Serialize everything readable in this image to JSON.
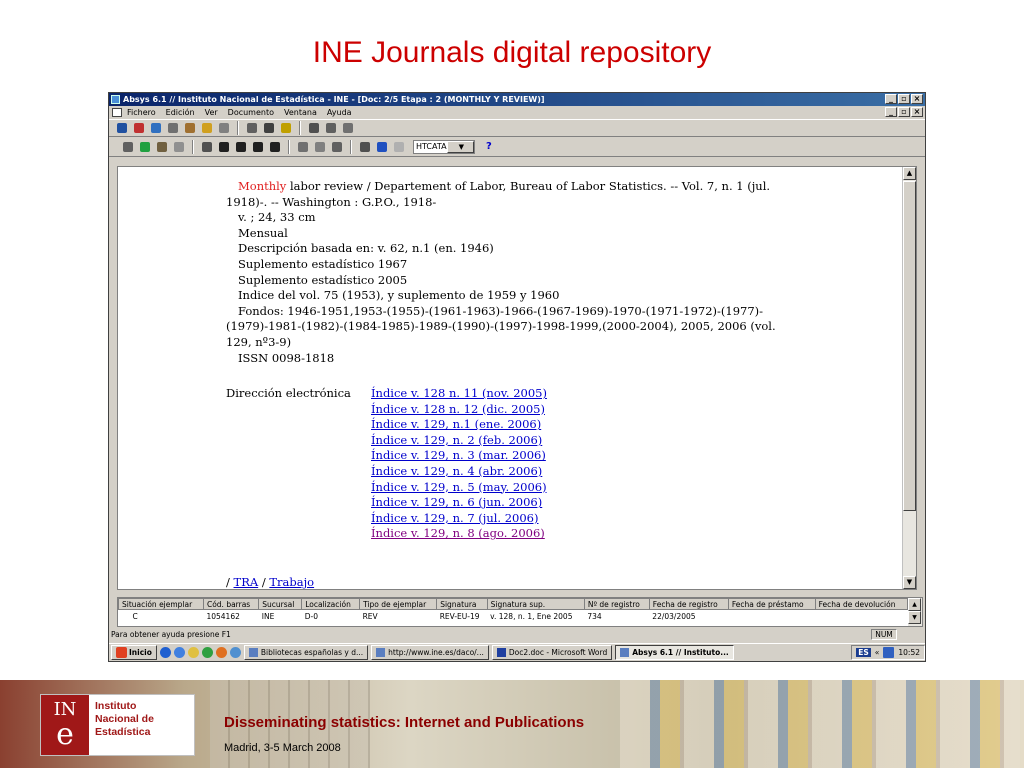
{
  "slide": {
    "title": "INE Journals digital repository",
    "footer_title": "Disseminating statistics: Internet and Publications",
    "footer_subtitle": "Madrid, 3-5 March 2008",
    "logo_lines": [
      "Instituto",
      "Nacional de",
      "Estadística"
    ],
    "logo_mark_top": "IN",
    "logo_mark_bottom": "e"
  },
  "window": {
    "title": "Absys 6.1 // Instituto Nacional de Estadística - INE - [Doc: 2/5  Etapa : 2 (MONTHLY Y REVIEW)]",
    "menu": [
      "Fichero",
      "Edición",
      "Ver",
      "Documento",
      "Ventana",
      "Ayuda"
    ],
    "combo_value": "HTCATA",
    "help_label": "?"
  },
  "record": {
    "highlight": "Monthly",
    "line1_rest": " labor review / Departement of Labor, Bureau of Labor Statistics. -- Vol. 7, n. 1 (jul. 1918)-. -- Washington : G.P.O., 1918-",
    "lines": [
      "v. ; 24, 33 cm",
      "Mensual",
      "Descripción basada en: v. 62, n.1 (en. 1946)",
      "Suplemento estadístico 1967",
      "Suplemento estadístico 2005",
      "Indice del vol. 75 (1953), y suplemento de 1959 y 1960",
      "Fondos: 1946-1951,1953-(1955)-(1961-1963)-1966-(1967-1969)-1970-(1971-1972)-(1977)-(1979)-1981-(1982)-(1984-1985)-1989-(1990)-(1997)-1998-1999,(2000-2004), 2005, 2006 (vol. 129, nº3-9)",
      "ISSN 0098-1818"
    ],
    "dir_label": "Dirección electrónica",
    "links": [
      "Índice v. 128 n. 11 (nov. 2005)",
      "Índice v. 128 n. 12 (dic. 2005)",
      "Índice v. 129, n.1 (ene. 2006)",
      "Índice v. 129, n. 2 (feb. 2006)",
      "Índice v. 129, n. 3 (mar. 2006)",
      "Índice v. 129, n. 4 (abr. 2006)",
      "Índice v. 129, n. 5 (may. 2006)",
      "Índice v. 129, n. 6 (jun. 2006)",
      "Índice v. 129, n. 7 (jul. 2006)",
      "Índice v. 129, n. 8 (ago. 2006)"
    ],
    "tra_prefix": "/ ",
    "tra_link1": "TRA",
    "tra_sep": " / ",
    "tra_link2": "Trabajo"
  },
  "grid": {
    "headers": [
      "Situación ejemplar",
      "Cód. barras",
      "Sucursal",
      "Localización",
      "Tipo de ejemplar",
      "Signatura",
      "Signatura sup.",
      "Nº de registro",
      "Fecha de registro",
      "Fecha de préstamo",
      "Fecha de devolución"
    ],
    "row": [
      "C",
      "1054162",
      "INE",
      "D-0",
      "REV",
      "REV-EU-19",
      "v. 128, n. 1,  Ene  2005",
      "734",
      "22/03/2005",
      "",
      ""
    ]
  },
  "status": {
    "text": "Para obtener ayuda presione F1",
    "num": "NUM"
  },
  "taskbar": {
    "start": "Inicio",
    "tasks": [
      "Bibliotecas españolas y d...",
      "http://www.ine.es/daco/...",
      "Doc2.doc - Microsoft Word",
      "Absys 6.1 // Instituto..."
    ],
    "lang": "ES",
    "tray_glyph": "«",
    "clock": "10:52"
  },
  "colors": {
    "title_red": "#cc0000",
    "link_blue": "#0000cc",
    "visited": "#800080",
    "ine_red": "#a01818"
  }
}
